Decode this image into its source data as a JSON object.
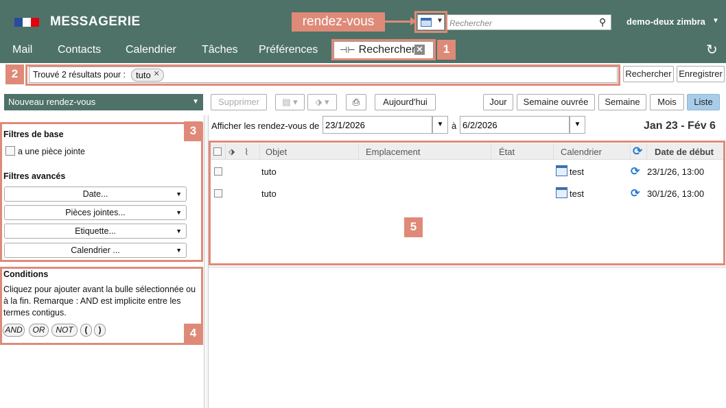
{
  "header": {
    "app_title": "MESSAGERIE",
    "search_placeholder": "Rechercher",
    "user_name": "demo-deux zimbra",
    "colors": {
      "header_bg": "#4e7268",
      "annotation": "#df8a78"
    }
  },
  "nav": {
    "tabs": [
      "Mail",
      "Contacts",
      "Calendrier",
      "Tâches",
      "Préférences"
    ],
    "search_tab_label": "Rechercher"
  },
  "annotations": {
    "label": "rendez-vous",
    "numbers": [
      "1",
      "2",
      "3",
      "4",
      "5"
    ]
  },
  "results": {
    "found_label": "Trouvé 2 résultats pour :",
    "query": "tuto",
    "search_button": "Rechercher",
    "save_button": "Enregistrer"
  },
  "toolbar": {
    "new_appointment": "Nouveau rendez-vous",
    "delete": "Supprimer",
    "today": "Aujourd'hui",
    "views": [
      "Jour",
      "Semaine ouvrée",
      "Semaine",
      "Mois",
      "Liste"
    ],
    "active_view": "Liste"
  },
  "filters": {
    "basic_title": "Filtres de base",
    "attachment_checkbox": "a une pièce jointe",
    "advanced_title": "Filtres avancés",
    "advanced": [
      "Date...",
      "Pièces jointes...",
      "Etiquette...",
      "Calendrier ..."
    ]
  },
  "conditions": {
    "title": "Conditions",
    "help": "Cliquez pour ajouter avant la bulle sélectionnée ou à la fin. Remarque : AND est implicite entre les termes contigus.",
    "ops": [
      "AND",
      "OR",
      "NOT",
      "(",
      ")"
    ]
  },
  "date_filter": {
    "label": "Afficher les rendez-vous de",
    "from": "23/1/2026",
    "to_label": "à",
    "to": "6/2/2026",
    "range_title": "Jan 23 - Fév 6"
  },
  "list": {
    "columns": [
      "Objet",
      "Emplacement",
      "État",
      "Calendrier",
      "Date de début"
    ],
    "rows": [
      {
        "subject": "tuto",
        "calendar": "test",
        "start": "23/1/26, 13:00"
      },
      {
        "subject": "tuto",
        "calendar": "test",
        "start": "30/1/26, 13:00"
      }
    ]
  }
}
